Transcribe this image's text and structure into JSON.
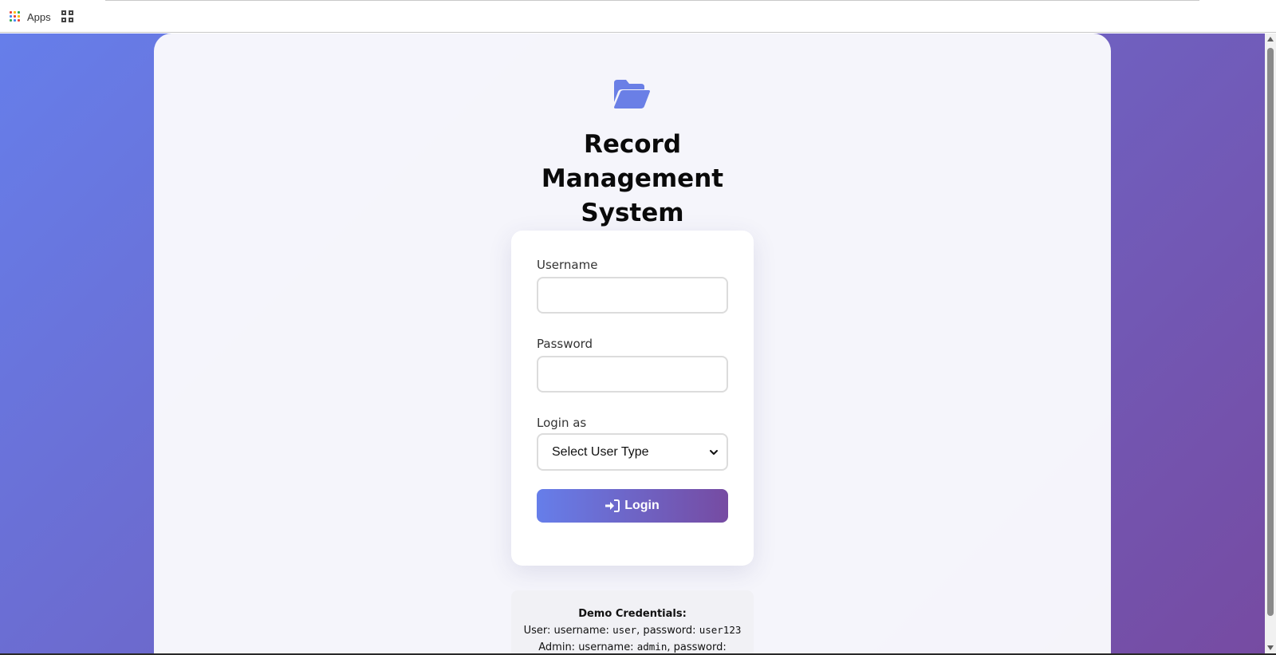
{
  "bookmarks": {
    "apps_label": "Apps",
    "apps_icon": "apps-grid-icon",
    "tab_groups_icon": "tab-groups-icon"
  },
  "colors": {
    "gradient_start": "#667eea",
    "gradient_end": "#764ba2",
    "logo": "#6a7fe6"
  },
  "header": {
    "logo_icon": "folder-open-icon",
    "title": "Record Management System"
  },
  "login_form": {
    "username_label": "Username",
    "username_value": "",
    "password_label": "Password",
    "password_value": "",
    "role_label": "Login as",
    "role_selected": "Select User Type",
    "login_button": "Login",
    "login_button_icon": "sign-in-icon"
  },
  "demo": {
    "title": "Demo Credentials:",
    "user_prefix": "User: username:",
    "user_username": "user",
    "password_label": ", password:",
    "user_password": "user123",
    "admin_prefix": "Admin: username:",
    "admin_username": "admin",
    "admin_password_label": ", password:"
  }
}
